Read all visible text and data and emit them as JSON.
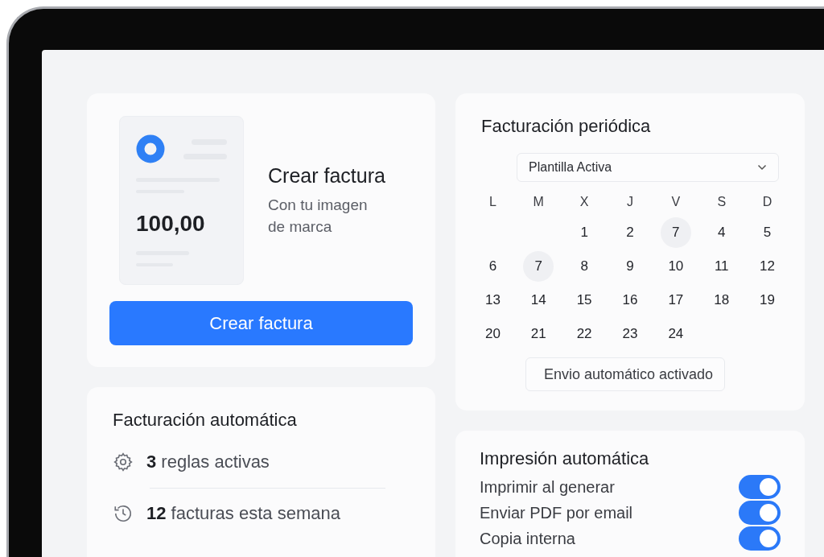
{
  "invoice_card": {
    "preview_amount": "100,00",
    "title": "Crear factura",
    "subtitle": "Con tu imagen de marca",
    "button": "Crear factura"
  },
  "periodic_billing": {
    "title": "Facturación periódica",
    "template_select": {
      "value": "Plantilla Activa"
    },
    "weekdays": [
      "L",
      "M",
      "X",
      "J",
      "V",
      "S",
      "D"
    ],
    "weeks": [
      [
        {
          "kind": "blank"
        },
        {
          "kind": "blank"
        },
        {
          "label": "1",
          "selected": false
        },
        {
          "label": "2",
          "selected": false
        },
        {
          "label": "7",
          "selected": true
        },
        {
          "label": "4",
          "selected": false
        },
        {
          "label": "5",
          "selected": false
        }
      ],
      [
        {
          "label": "6",
          "selected": false
        },
        {
          "label": "7",
          "selected": true
        },
        {
          "label": "8",
          "selected": false
        },
        {
          "label": "9",
          "selected": false
        },
        {
          "label": "10",
          "selected": false
        },
        {
          "label": "11",
          "selected": false
        },
        {
          "label": "12",
          "selected": false
        }
      ],
      [
        {
          "label": "13",
          "selected": false
        },
        {
          "label": "14",
          "selected": false
        },
        {
          "label": "15",
          "selected": false
        },
        {
          "label": "16",
          "selected": false
        },
        {
          "label": "17",
          "selected": false
        },
        {
          "label": "18",
          "selected": false
        },
        {
          "label": "19",
          "selected": false
        }
      ],
      [
        {
          "label": "20",
          "selected": false
        },
        {
          "label": "21",
          "selected": false
        },
        {
          "label": "22",
          "selected": false
        },
        {
          "label": "23",
          "selected": false
        },
        {
          "label": "24",
          "selected": false
        },
        {
          "kind": "blank"
        },
        {
          "kind": "blank"
        }
      ]
    ],
    "status_chip": "Envio automático activado"
  },
  "auto_billing": {
    "title": "Facturación automática",
    "items": [
      {
        "kind": "gear",
        "text": "**3** reglas activas"
      },
      {
        "kind": "clock",
        "text": "**12** facturas esta semana"
      }
    ]
  },
  "auto_print": {
    "title": "Impresión automática",
    "options": [
      {
        "label": "Imprimir al generar",
        "on": true
      },
      {
        "label": "Enviar PDF por email",
        "on": true
      },
      {
        "label": "Copia interna",
        "on": true
      }
    ]
  }
}
